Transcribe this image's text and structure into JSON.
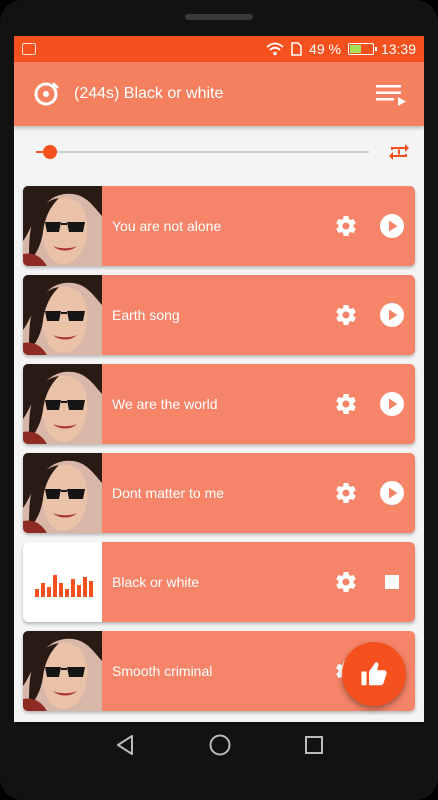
{
  "status": {
    "battery_percent": "49 %",
    "time": "13:39",
    "battery_level": 0.49
  },
  "appbar": {
    "title": "(244s) Black or white",
    "logo_icon": "music-disc-icon",
    "queue_icon": "playlist-play-icon"
  },
  "player": {
    "progress": 0.03,
    "repeat_icon": "repeat-one-icon"
  },
  "songs": [
    {
      "title": "You are not alone",
      "state": "play"
    },
    {
      "title": "Earth song",
      "state": "play"
    },
    {
      "title": "We are the world",
      "state": "play"
    },
    {
      "title": "Dont matter to me",
      "state": "play"
    },
    {
      "title": "Black or white",
      "state": "stop"
    },
    {
      "title": "Smooth criminal",
      "state": "play"
    }
  ],
  "fab": {
    "icon": "thumbs-up-icon"
  },
  "colors": {
    "accent": "#f4511e",
    "card": "#f58468",
    "appbar": "#f4805f"
  }
}
